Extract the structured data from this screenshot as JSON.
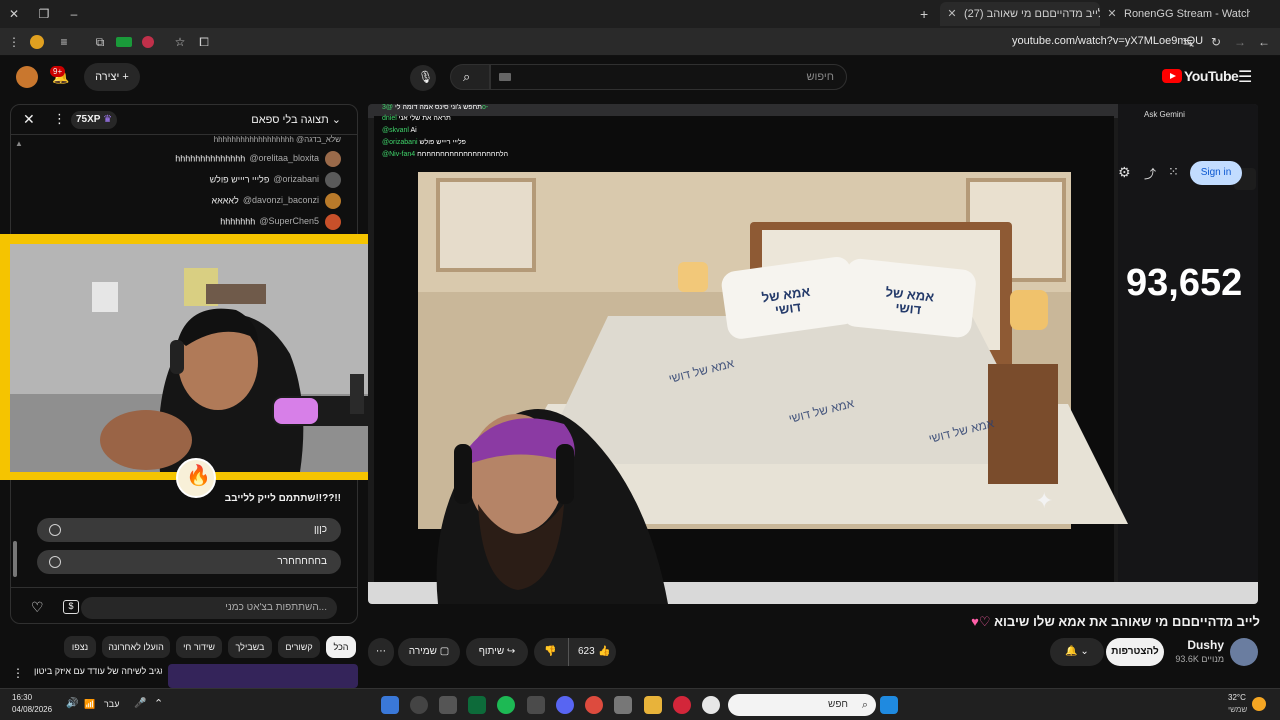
{
  "browser": {
    "tabs": [
      {
        "label": "RonenGG Stream - Watch Live o",
        "active": false
      },
      {
        "label": "(27) לייב מדהייםםם מי שאוהב",
        "active": true
      }
    ],
    "url": "youtube.com/watch?v=yX7MLoe9mQU"
  },
  "youtube": {
    "search_placeholder": "חיפוש",
    "create_label": "יצירה",
    "notification_count": "9+",
    "logo_text": "YouTube"
  },
  "chat": {
    "header_title": "תצוגה בלי ספאם",
    "xp_badge": "75XP",
    "messages": [
      {
        "author": "@orelitaa_bloxita",
        "text": "hhhhhhhhhhhhhh"
      },
      {
        "author": "@orizabani",
        "text": "פלייי ריייש פולש"
      },
      {
        "author": "@davonzi_baconzi",
        "text": "לאאאא"
      },
      {
        "author": "@SuperChen5",
        "text": "hhhhhhh"
      }
    ],
    "poll_question": "שתתמם לייק ללייבב!!??!!",
    "poll_options": [
      "כןןן",
      "בחחחחחרר"
    ],
    "input_placeholder": "השתתפות בצ'אט כמני..."
  },
  "video_overlay": {
    "chat_lines": [
      {
        "author": "@3o-",
        "text": "תחפש ג'וני סינס אמה דומה לי"
      },
      {
        "author": "dniel",
        "text": "תראה את שלי אני"
      },
      {
        "author": "@skvanl",
        "text": "Ai"
      },
      {
        "author": "@orizabani",
        "text": "פלייי ריייש פולש"
      },
      {
        "author": "@Niv-fan4",
        "text": "הלחחחחחחחחחחחחחחחחחח"
      }
    ],
    "pillow_left": "אמא של דושי",
    "pillow_right": "אמא של דושי",
    "blanket_text": "אמא של דושי",
    "counter": "93,652",
    "signin_label": "Sign in",
    "ask_label": "Ask Gemini"
  },
  "video": {
    "title": "לייב מדהייםםם מי שאוהב את אמא שלו שיבוא",
    "channel_name": "Dushy",
    "subscribers": "93.6K מנויים",
    "subscribe_label": "להצטרפות",
    "likes": "623",
    "share_label": "שיתוף",
    "save_label": "שמירה"
  },
  "filters": [
    "הכל",
    "קשורים",
    "בשבילך",
    "שידור חי",
    "הועלו לאחרונה",
    "נצפו"
  ],
  "sidebar_preview": "רונן מגיב לשיחה של עודד עם איזק ביטון",
  "taskbar": {
    "time": "16:30",
    "date": "04/08/2026",
    "lang": "עבר",
    "search_label": "חפש",
    "weather": "32°C",
    "weather_desc": "שמשי"
  }
}
